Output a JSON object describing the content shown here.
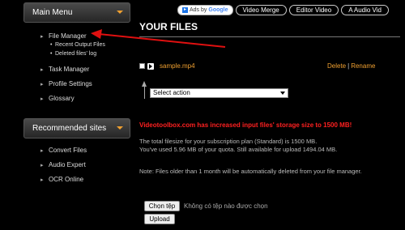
{
  "sidebar": {
    "main_menu": {
      "title": "Main Menu",
      "items": [
        {
          "label": "File Manager"
        },
        {
          "label": "Task Manager"
        },
        {
          "label": "Profile Settings"
        },
        {
          "label": "Glossary"
        }
      ],
      "subitems": [
        {
          "label": "Recent Output Files"
        },
        {
          "label": "Deleted files' log"
        }
      ]
    },
    "recommended": {
      "title": "Recommended sites",
      "items": [
        {
          "label": "Convert Files"
        },
        {
          "label": "Audio Expert"
        },
        {
          "label": "OCR Online"
        }
      ]
    }
  },
  "topbar": {
    "ads_label": "Ads by",
    "ads_brand": "Google",
    "tabs": [
      {
        "label": "Video Merge"
      },
      {
        "label": "Editor Video"
      },
      {
        "label": "A Audio Vid"
      }
    ]
  },
  "main": {
    "title": "YOUR FILES",
    "file": {
      "name": "sample.mp4",
      "delete_label": "Delete",
      "rename_label": "Rename"
    },
    "select_action": "Select action",
    "notice": "Videotoolbox.com has increased input files' storage size to 1500 MB!",
    "quota_line1": "The total filesize for your subscription plan (Standard) is 1500 MB.",
    "quota_line2": "You've used 5.96 MB of your quota. Still available for upload 1494.04 MB.",
    "note": "Note: Files older than 1 month will be automatically deleted from your file manager.",
    "choose_file_label": "Chọn tệp",
    "no_file_label": "Không có tệp nào được chọn",
    "upload_label": "Upload"
  },
  "colors": {
    "accent": "#f0a030",
    "notice": "#ff2020",
    "annotation_arrow": "#e01010"
  }
}
